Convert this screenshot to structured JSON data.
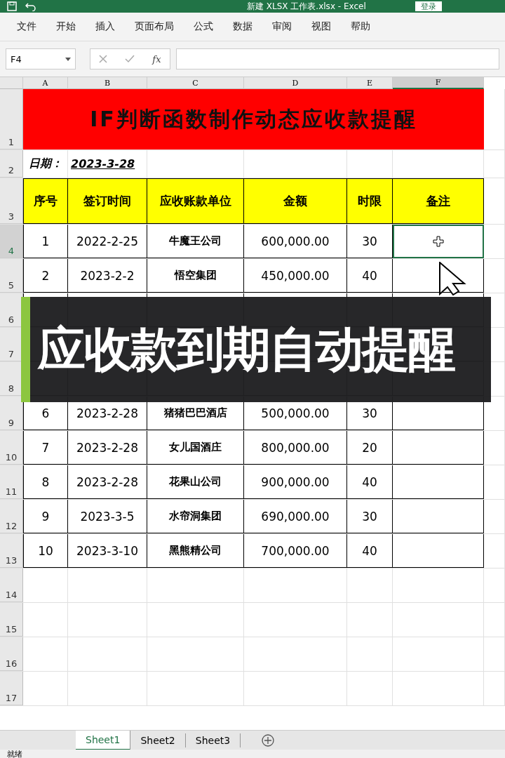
{
  "titlebar": {
    "title": "新建 XLSX 工作表.xlsx  -  Excel",
    "login": "登录"
  },
  "menu": [
    "文件",
    "开始",
    "插入",
    "页面布局",
    "公式",
    "数据",
    "审阅",
    "视图",
    "帮助"
  ],
  "formula_bar": {
    "name_box": "F4",
    "function_label": "fx"
  },
  "columns": [
    {
      "label": "A",
      "selected": false
    },
    {
      "label": "B",
      "selected": false
    },
    {
      "label": "C",
      "selected": false
    },
    {
      "label": "D",
      "selected": false
    },
    {
      "label": "E",
      "selected": false
    },
    {
      "label": "F",
      "selected": true
    }
  ],
  "sheet": {
    "top_rows": [
      "1",
      "2",
      "3"
    ],
    "title": "IF判断函数制作动态应收款提醒",
    "date_label": "日期：",
    "date": "2023-3-28",
    "headers": [
      "序号",
      "签订时间",
      "应收账款单位",
      "金额",
      "时限",
      "备注"
    ],
    "rows": [
      {
        "row": "4",
        "selected": true,
        "cells": [
          "1",
          "2022-2-25",
          "牛魔王公司",
          "600,000.00",
          "30",
          ""
        ]
      },
      {
        "row": "5",
        "selected": false,
        "cells": [
          "2",
          "2023-2-2",
          "悟空集团",
          "450,000.00",
          "40",
          ""
        ]
      },
      {
        "row": "6",
        "selected": false
      },
      {
        "row": "7",
        "selected": false
      },
      {
        "row": "8",
        "selected": false
      },
      {
        "row": "9",
        "selected": false,
        "cells": [
          "6",
          "2023-2-28",
          "猪猪巴巴酒店",
          "500,000.00",
          "30",
          ""
        ]
      },
      {
        "row": "10",
        "selected": false,
        "cells": [
          "7",
          "2023-2-28",
          "女儿国酒庄",
          "800,000.00",
          "20",
          ""
        ]
      },
      {
        "row": "11",
        "selected": false,
        "cells": [
          "8",
          "2023-2-28",
          "花果山公司",
          "900,000.00",
          "40",
          ""
        ]
      },
      {
        "row": "12",
        "selected": false,
        "cells": [
          "9",
          "2023-3-5",
          "水帘洞集团",
          "690,000.00",
          "30",
          ""
        ]
      },
      {
        "row": "13",
        "selected": false,
        "cells": [
          "10",
          "2023-3-10",
          "黑熊精公司",
          "700,000.00",
          "40",
          ""
        ]
      }
    ],
    "empty_rows": [
      "14",
      "15",
      "16",
      "17"
    ]
  },
  "banner": "应收款到期自动提醒",
  "sheet_tabs": [
    {
      "label": "Sheet1",
      "selected": true
    },
    {
      "label": "Sheet2",
      "selected": false
    },
    {
      "label": "Sheet3",
      "selected": false
    }
  ],
  "status": "就绪"
}
